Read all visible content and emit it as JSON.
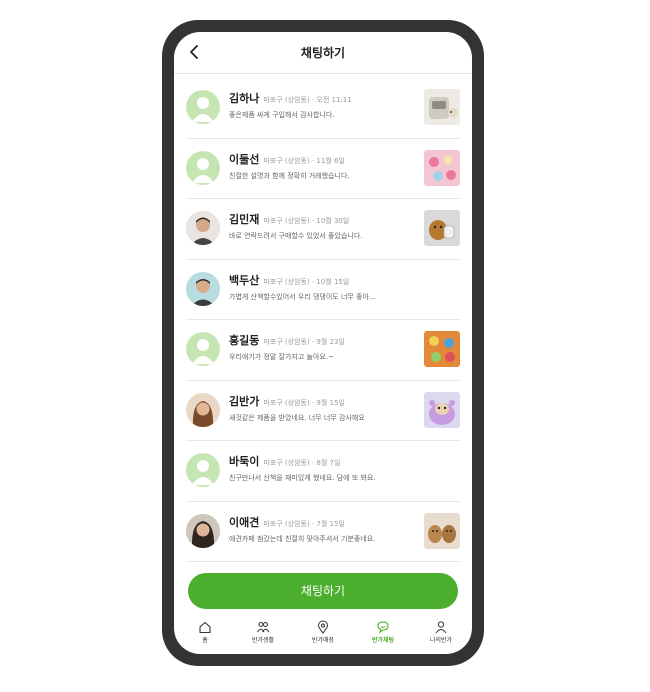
{
  "header": {
    "title": "채팅하기"
  },
  "chats": [
    {
      "name": "김하나",
      "location": "마포구 (상암동)",
      "time": "오전 11:11",
      "message": "좋은제품 싸게 구입해서 감사합니다.",
      "avatar": "default-avatar-icon",
      "thumb": "cat-carrier-photo"
    },
    {
      "name": "이둘선",
      "location": "마포구 (상암동)",
      "time": "11월 6일",
      "message": "친절한 설명과 함께 정확히 거래했습니다.",
      "avatar": "default-avatar-icon",
      "thumb": "pet-toys-photo"
    },
    {
      "name": "김민재",
      "location": "마포구 (상암동)",
      "time": "10월 30일",
      "message": "바로 연락드려서 구매할수 있었서 좋았습니다.",
      "avatar": "user-photo",
      "thumb": "dog-with-toy-photo"
    },
    {
      "name": "백두산",
      "location": "마포구 (상암동)",
      "time": "10월 15일",
      "message": "가볍게 산책할수있어서 우리 댕댕이도 너무 좋아...",
      "avatar": "user-photo",
      "thumb": ""
    },
    {
      "name": "홍길동",
      "location": "마포구 (상암동)",
      "time": "9월 23일",
      "message": "우리애기가 정말 잘가지고 놀아요.~",
      "avatar": "default-avatar-icon",
      "thumb": "pet-toys-photo"
    },
    {
      "name": "김반가",
      "location": "마포구 (상암동)",
      "time": "9월 15일",
      "message": "새것같은 제품을 받았네요. 너무 너무 감사해요",
      "avatar": "user-photo",
      "thumb": "dog-costume-photo"
    },
    {
      "name": "바둑이",
      "location": "마포구 (상암동)",
      "time": "8월 7일",
      "message": "친구만나서 산책을 재미있게 했네요. 담에 또 봐요.",
      "avatar": "default-avatar-icon",
      "thumb": ""
    },
    {
      "name": "이애견",
      "location": "마포구 (상암동)",
      "time": "7월 15일",
      "message": "애견카페 첨갔는데 친절히 맞아주셔서 기분좋네요.",
      "avatar": "user-photo",
      "thumb": "puppies-photo"
    }
  ],
  "chat_button": {
    "label": "채팅하기"
  },
  "tabs": [
    {
      "label": "홈",
      "icon": "home-icon",
      "active": false
    },
    {
      "label": "반가생활",
      "icon": "people-icon",
      "active": false
    },
    {
      "label": "반가매장",
      "icon": "location-pin-icon",
      "active": false
    },
    {
      "label": "반가채팅",
      "icon": "chat-icon",
      "active": true
    },
    {
      "label": "나의반가",
      "icon": "person-icon",
      "active": false
    }
  ],
  "colors": {
    "accent": "#4cae2d",
    "avatar_bg": "#c5e6b2"
  }
}
